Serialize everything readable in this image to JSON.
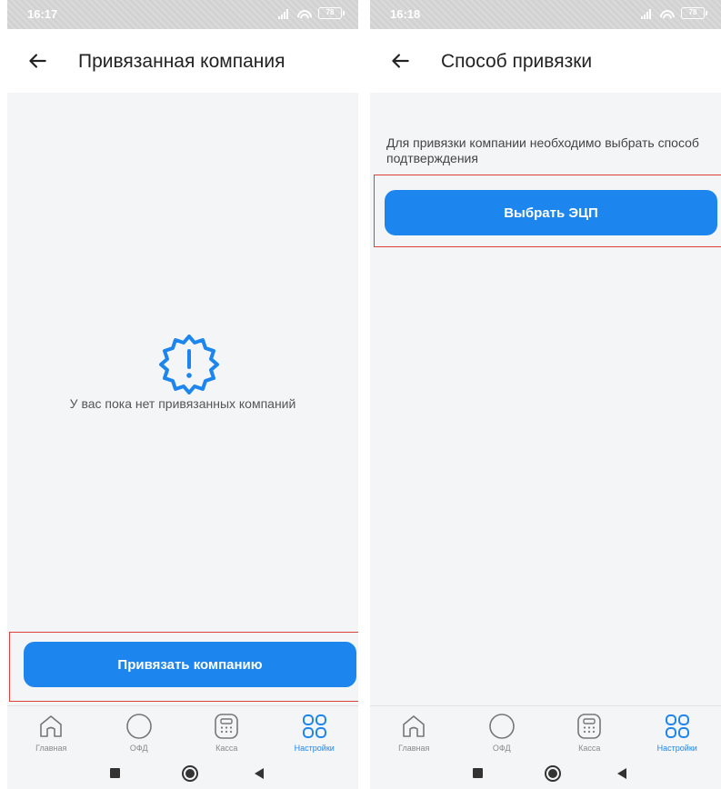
{
  "colors": {
    "accent": "#1d86ee",
    "highlight": "#d9413a",
    "background": "#f4f5f7"
  },
  "left": {
    "status": {
      "time": "16:17",
      "battery": "78"
    },
    "appbar": {
      "title": "Привязанная компания",
      "back_icon": "arrow-left-icon"
    },
    "empty_state": {
      "icon": "warning-badge-icon",
      "text": "У вас пока нет привязанных компаний"
    },
    "button": {
      "label": "Привязать компанию"
    }
  },
  "right": {
    "status": {
      "time": "16:18",
      "battery": "78"
    },
    "appbar": {
      "title": "Способ привязки",
      "back_icon": "arrow-left-icon"
    },
    "hint": "Для привязки компании необходимо выбрать способ подтверждения",
    "button": {
      "label": "Выбрать ЭЦП"
    }
  },
  "nav": {
    "items": [
      {
        "label": "Главная",
        "icon": "home-icon"
      },
      {
        "label": "ОФД",
        "icon": "circle-icon"
      },
      {
        "label": "Касса",
        "icon": "calculator-icon"
      },
      {
        "label": "Настройки",
        "icon": "grid-icon",
        "active": true
      }
    ]
  }
}
